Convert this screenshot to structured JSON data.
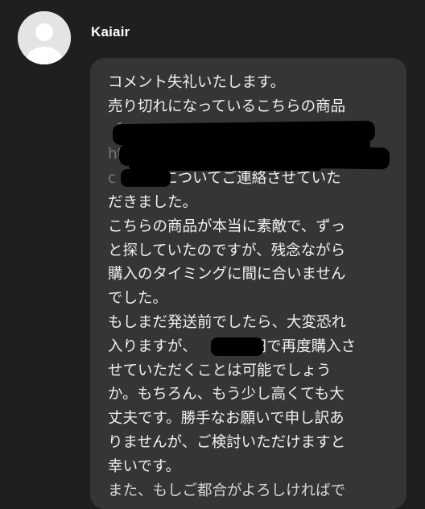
{
  "comment": {
    "author": {
      "name": "Kaiair",
      "avatar_icon": "default-user-avatar-icon"
    },
    "message_lines": [
      "コメント失礼いたします。",
      "売り切れになっているこちらの商品",
      "【",
      "htt",
      "c",
      "についてご連絡させていた",
      "だきました。",
      "こちらの商品が本当に素敵で、ずっ",
      "と探していたのですが、残念ながら",
      "購入のタイミングに間に合いません",
      "でした。",
      "もしまだ発送前でしたら、大変恐れ",
      "入りますが、",
      "円で再度購入さ",
      "せていただくことは可能でしょう",
      "か。もちろん、もう少し高くても大",
      "丈夫です。勝手なお願いで申し訳あ",
      "りませんが、ご検討いただけますと",
      "幸いです。",
      "また、もしご都合がよろしければで"
    ]
  },
  "colors": {
    "background": "#1f1f1f",
    "bubble": "#353535",
    "text": "#f0f0f0",
    "redaction": "#000000"
  }
}
